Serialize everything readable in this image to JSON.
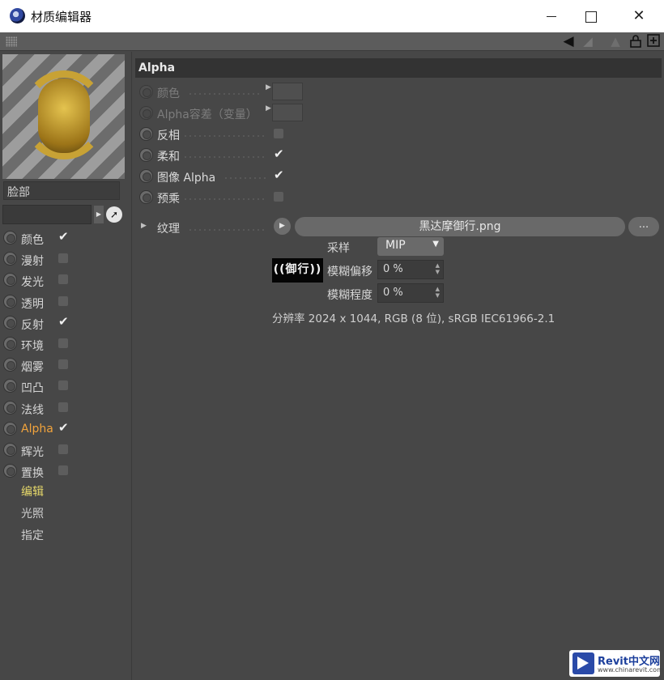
{
  "window": {
    "title": "材质编辑器",
    "minimize_glyph": "",
    "close_glyph": "✕"
  },
  "toolbar": {
    "icons": [
      "grip-icon",
      "back-arrow-icon",
      "forward-arrow-icon",
      "up-arrow-icon",
      "lock-icon",
      "new-window-icon"
    ]
  },
  "material": {
    "name": "脸部",
    "preview_glyph": "御\n行"
  },
  "channels": [
    {
      "label": "颜色",
      "checked": true
    },
    {
      "label": "漫射",
      "checked": false
    },
    {
      "label": "发光",
      "checked": false
    },
    {
      "label": "透明",
      "checked": false
    },
    {
      "label": "反射",
      "checked": true
    },
    {
      "label": "环境",
      "checked": false
    },
    {
      "label": "烟雾",
      "checked": false
    },
    {
      "label": "凹凸",
      "checked": false
    },
    {
      "label": "法线",
      "checked": false
    },
    {
      "label": "Alpha",
      "checked": true,
      "active": true
    },
    {
      "label": "辉光",
      "checked": false
    },
    {
      "label": "置换",
      "checked": false
    }
  ],
  "sub_tabs": [
    {
      "label": "编辑",
      "active": true
    },
    {
      "label": "光照",
      "active": false
    },
    {
      "label": "指定",
      "active": false
    }
  ],
  "section": {
    "title": "Alpha"
  },
  "params": {
    "color": {
      "label": "颜色"
    },
    "alpha_tolerance": {
      "label": "Alpha容差（变量）"
    },
    "invert": {
      "label": "反相",
      "checked": false
    },
    "soft": {
      "label": "柔和",
      "checked": true
    },
    "image_alpha": {
      "label": "图像 Alpha",
      "checked": true
    },
    "premultiply": {
      "label": "预乘",
      "checked": false
    }
  },
  "texture": {
    "label": "纹理",
    "file": "黑达摩御行.png",
    "more": "...",
    "thumb_text": "((御行))",
    "sampling_label": "采样",
    "sampling_value": "MIP",
    "blur_offset_label": "模糊偏移",
    "blur_offset_value": "0 %",
    "blur_scale_label": "模糊程度",
    "blur_scale_value": "0 %",
    "resolution": "分辨率 2024 x 1044, RGB (8 位), sRGB IEC61966-2.1"
  },
  "watermark": {
    "brand": "Revit中文网",
    "url": "www.chinarevit.com"
  },
  "colors": {
    "active_channel": "#f1a33c",
    "active_subtab": "#e6d86a",
    "panel_bg": "#474747",
    "header_bg": "#333333"
  }
}
